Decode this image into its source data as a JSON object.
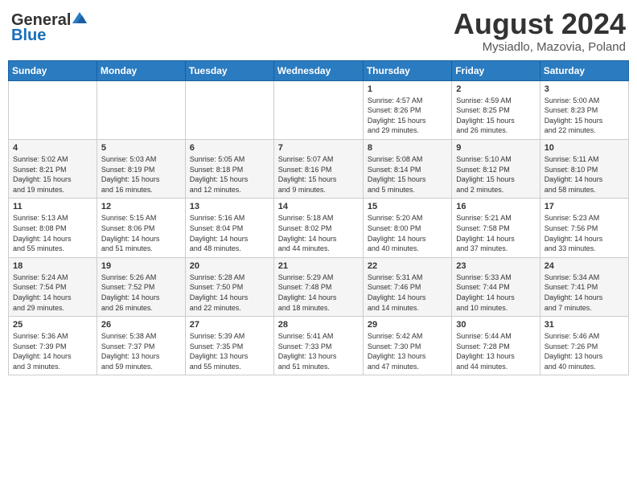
{
  "header": {
    "logo_general": "General",
    "logo_blue": "Blue",
    "title": "August 2024",
    "location": "Mysiadlo, Mazovia, Poland"
  },
  "calendar": {
    "weekdays": [
      "Sunday",
      "Monday",
      "Tuesday",
      "Wednesday",
      "Thursday",
      "Friday",
      "Saturday"
    ],
    "weeks": [
      [
        {
          "day": "",
          "info": ""
        },
        {
          "day": "",
          "info": ""
        },
        {
          "day": "",
          "info": ""
        },
        {
          "day": "",
          "info": ""
        },
        {
          "day": "1",
          "info": "Sunrise: 4:57 AM\nSunset: 8:26 PM\nDaylight: 15 hours\nand 29 minutes."
        },
        {
          "day": "2",
          "info": "Sunrise: 4:59 AM\nSunset: 8:25 PM\nDaylight: 15 hours\nand 26 minutes."
        },
        {
          "day": "3",
          "info": "Sunrise: 5:00 AM\nSunset: 8:23 PM\nDaylight: 15 hours\nand 22 minutes."
        }
      ],
      [
        {
          "day": "4",
          "info": "Sunrise: 5:02 AM\nSunset: 8:21 PM\nDaylight: 15 hours\nand 19 minutes."
        },
        {
          "day": "5",
          "info": "Sunrise: 5:03 AM\nSunset: 8:19 PM\nDaylight: 15 hours\nand 16 minutes."
        },
        {
          "day": "6",
          "info": "Sunrise: 5:05 AM\nSunset: 8:18 PM\nDaylight: 15 hours\nand 12 minutes."
        },
        {
          "day": "7",
          "info": "Sunrise: 5:07 AM\nSunset: 8:16 PM\nDaylight: 15 hours\nand 9 minutes."
        },
        {
          "day": "8",
          "info": "Sunrise: 5:08 AM\nSunset: 8:14 PM\nDaylight: 15 hours\nand 5 minutes."
        },
        {
          "day": "9",
          "info": "Sunrise: 5:10 AM\nSunset: 8:12 PM\nDaylight: 15 hours\nand 2 minutes."
        },
        {
          "day": "10",
          "info": "Sunrise: 5:11 AM\nSunset: 8:10 PM\nDaylight: 14 hours\nand 58 minutes."
        }
      ],
      [
        {
          "day": "11",
          "info": "Sunrise: 5:13 AM\nSunset: 8:08 PM\nDaylight: 14 hours\nand 55 minutes."
        },
        {
          "day": "12",
          "info": "Sunrise: 5:15 AM\nSunset: 8:06 PM\nDaylight: 14 hours\nand 51 minutes."
        },
        {
          "day": "13",
          "info": "Sunrise: 5:16 AM\nSunset: 8:04 PM\nDaylight: 14 hours\nand 48 minutes."
        },
        {
          "day": "14",
          "info": "Sunrise: 5:18 AM\nSunset: 8:02 PM\nDaylight: 14 hours\nand 44 minutes."
        },
        {
          "day": "15",
          "info": "Sunrise: 5:20 AM\nSunset: 8:00 PM\nDaylight: 14 hours\nand 40 minutes."
        },
        {
          "day": "16",
          "info": "Sunrise: 5:21 AM\nSunset: 7:58 PM\nDaylight: 14 hours\nand 37 minutes."
        },
        {
          "day": "17",
          "info": "Sunrise: 5:23 AM\nSunset: 7:56 PM\nDaylight: 14 hours\nand 33 minutes."
        }
      ],
      [
        {
          "day": "18",
          "info": "Sunrise: 5:24 AM\nSunset: 7:54 PM\nDaylight: 14 hours\nand 29 minutes."
        },
        {
          "day": "19",
          "info": "Sunrise: 5:26 AM\nSunset: 7:52 PM\nDaylight: 14 hours\nand 26 minutes."
        },
        {
          "day": "20",
          "info": "Sunrise: 5:28 AM\nSunset: 7:50 PM\nDaylight: 14 hours\nand 22 minutes."
        },
        {
          "day": "21",
          "info": "Sunrise: 5:29 AM\nSunset: 7:48 PM\nDaylight: 14 hours\nand 18 minutes."
        },
        {
          "day": "22",
          "info": "Sunrise: 5:31 AM\nSunset: 7:46 PM\nDaylight: 14 hours\nand 14 minutes."
        },
        {
          "day": "23",
          "info": "Sunrise: 5:33 AM\nSunset: 7:44 PM\nDaylight: 14 hours\nand 10 minutes."
        },
        {
          "day": "24",
          "info": "Sunrise: 5:34 AM\nSunset: 7:41 PM\nDaylight: 14 hours\nand 7 minutes."
        }
      ],
      [
        {
          "day": "25",
          "info": "Sunrise: 5:36 AM\nSunset: 7:39 PM\nDaylight: 14 hours\nand 3 minutes."
        },
        {
          "day": "26",
          "info": "Sunrise: 5:38 AM\nSunset: 7:37 PM\nDaylight: 13 hours\nand 59 minutes."
        },
        {
          "day": "27",
          "info": "Sunrise: 5:39 AM\nSunset: 7:35 PM\nDaylight: 13 hours\nand 55 minutes."
        },
        {
          "day": "28",
          "info": "Sunrise: 5:41 AM\nSunset: 7:33 PM\nDaylight: 13 hours\nand 51 minutes."
        },
        {
          "day": "29",
          "info": "Sunrise: 5:42 AM\nSunset: 7:30 PM\nDaylight: 13 hours\nand 47 minutes."
        },
        {
          "day": "30",
          "info": "Sunrise: 5:44 AM\nSunset: 7:28 PM\nDaylight: 13 hours\nand 44 minutes."
        },
        {
          "day": "31",
          "info": "Sunrise: 5:46 AM\nSunset: 7:26 PM\nDaylight: 13 hours\nand 40 minutes."
        }
      ]
    ]
  }
}
